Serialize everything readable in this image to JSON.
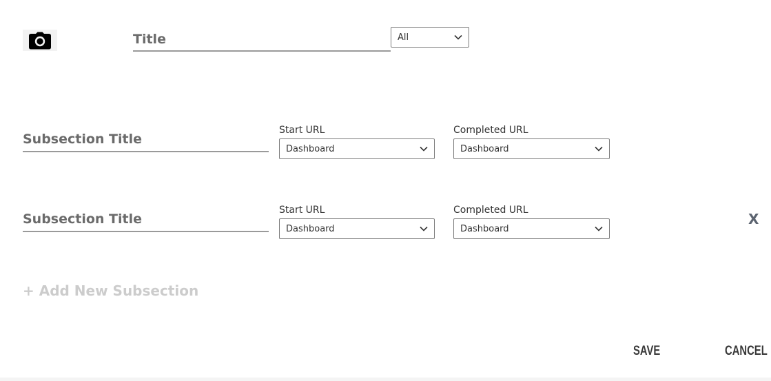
{
  "header": {
    "camera_icon": "camera-icon",
    "title_placeholder": "Title",
    "category_select": {
      "selected": "All"
    }
  },
  "subsections": [
    {
      "title_placeholder": "Subsection Title",
      "start_url_label": "Start URL",
      "start_url_value": "Dashboard",
      "completed_url_label": "Completed URL",
      "completed_url_value": "Dashboard"
    },
    {
      "title_placeholder": "Subsection Title",
      "start_url_label": "Start URL",
      "start_url_value": "Dashboard",
      "completed_url_label": "Completed URL",
      "completed_url_value": "Dashboard",
      "remove_label": "X"
    }
  ],
  "add_subsection_label": "+ Add New Subsection",
  "footer": {
    "save_label": "SAVE",
    "cancel_label": "CANCEL"
  },
  "colors": {
    "text": "#333333",
    "muted": "#6b6b6b",
    "disabled": "#cccccc",
    "underline": "#9a9a9a"
  }
}
